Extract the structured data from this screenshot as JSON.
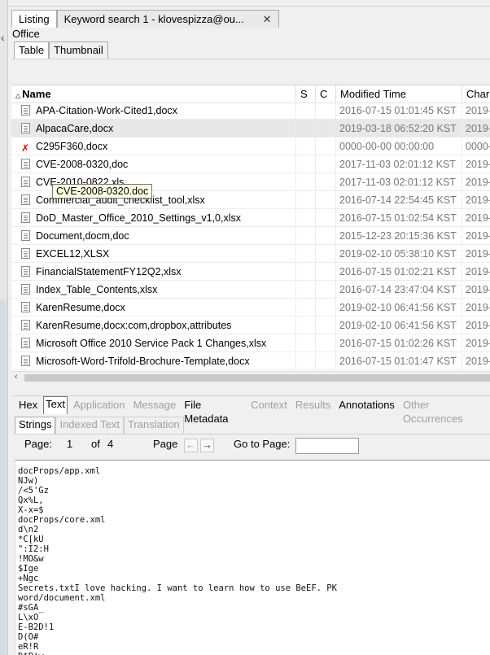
{
  "doc_tabs": [
    {
      "label": "Listing"
    },
    {
      "label": "Keyword search 1 - klovespizza@ou..."
    }
  ],
  "breadcrumb": "Office",
  "view_tabs": [
    "Table",
    "Thumbnail"
  ],
  "columns": {
    "name": "Name",
    "s": "S",
    "c": "C",
    "modified": "Modified Time",
    "change": "Char"
  },
  "rows": [
    {
      "name": "APA-Citation-Work-Cited1,docx",
      "modified": "2016-07-15 01:01:45 KST",
      "change": "2019-",
      "icon": "document-icon",
      "selected": false
    },
    {
      "name": "AlpacaCare,docx",
      "modified": "2019-03-18 06:52:20 KST",
      "change": "2019-",
      "icon": "document-icon",
      "selected": true
    },
    {
      "name": "C295F360,docx",
      "modified": "0000-00-00 00:00:00",
      "change": "0000-",
      "icon": "deleted-file-icon",
      "selected": false
    },
    {
      "name": "CVE-2008-0320,doc",
      "modified": "2017-11-03 02:01:12 KST",
      "change": "2019-",
      "icon": "document-icon",
      "selected": false
    },
    {
      "name": "CVE-2010-0822,xls",
      "modified": "2017-11-03 02:01:12 KST",
      "change": "2019-",
      "icon": "document-icon",
      "selected": false
    },
    {
      "name": "Commercial_audit_checklist_tool,xlsx",
      "modified": "2016-07-14 22:54:45 KST",
      "change": "2019-",
      "icon": "document-icon",
      "selected": false
    },
    {
      "name": "DoD_Master_Office_2010_Settings_v1,0,xlsx",
      "modified": "2016-07-15 01:02:54 KST",
      "change": "2019-",
      "icon": "document-icon",
      "selected": false
    },
    {
      "name": "Document,docm,doc",
      "modified": "2015-12-23 20:15:36 KST",
      "change": "2019-",
      "icon": "document-icon",
      "selected": false
    },
    {
      "name": "EXCEL12,XLSX",
      "modified": "2019-02-10 05:38:10 KST",
      "change": "2019-",
      "icon": "document-icon",
      "selected": false
    },
    {
      "name": "FinancialStatementFY12Q2,xlsx",
      "modified": "2016-07-15 01:02:21 KST",
      "change": "2019-",
      "icon": "document-icon",
      "selected": false
    },
    {
      "name": "Index_Table_Contents,xlsx",
      "modified": "2016-07-14 23:47:04 KST",
      "change": "2019-",
      "icon": "document-icon",
      "selected": false
    },
    {
      "name": "KarenResume,docx",
      "modified": "2019-02-10 06:41:56 KST",
      "change": "2019-",
      "icon": "document-icon",
      "selected": false
    },
    {
      "name": "KarenResume,docx:com,dropbox,attributes",
      "modified": "2019-02-10 06:41:56 KST",
      "change": "2019-",
      "icon": "document-icon",
      "selected": false
    },
    {
      "name": "Microsoft Office 2010 Service Pack 1 Changes,xlsx",
      "modified": "2016-07-15 01:02:26 KST",
      "change": "2019-",
      "icon": "document-icon",
      "selected": false
    },
    {
      "name": "Microsoft-Word-Trifold-Brochure-Template,docx",
      "modified": "2016-07-15 01:01:47 KST",
      "change": "2019-",
      "icon": "document-icon",
      "selected": false
    }
  ],
  "tooltip": "CVE-2008-0320.doc",
  "content_tabs": [
    {
      "label": "Hex",
      "state": "enabled"
    },
    {
      "label": "Text",
      "state": "active"
    },
    {
      "label": "Application",
      "state": "disabled"
    },
    {
      "label": "Message",
      "state": "disabled"
    },
    {
      "label": "File Metadata",
      "state": "enabled"
    },
    {
      "label": "Context",
      "state": "disabled"
    },
    {
      "label": "Results",
      "state": "disabled"
    },
    {
      "label": "Annotations",
      "state": "enabled"
    },
    {
      "label": "Other Occurrences",
      "state": "disabled"
    }
  ],
  "sub_tabs": [
    {
      "label": "Strings",
      "state": "active"
    },
    {
      "label": "Indexed Text",
      "state": "disabled"
    },
    {
      "label": "Translation",
      "state": "disabled"
    }
  ],
  "pager": {
    "page_label": "Page:",
    "current": "1",
    "of_label": "of",
    "total": "4",
    "page_nav_label": "Page",
    "goto_label": "Go to Page:",
    "goto_value": ""
  },
  "strings_text": "docProps/app.xml\nNJw)\n/<5'Gz\nQx%L,\nX-x=$\ndocProps/core.xml\nd\\n2\n*C[kU\n\":I2:H\n!MO&w\n$Ige\n+Ngc\nSecrets.txtI love hacking. I want to learn how to use BeEF. PK\nword/document.xml\n#sGA_\nL\\xO\nE-B2D!1\nD(O#\neR!R\nD$P!w"
}
